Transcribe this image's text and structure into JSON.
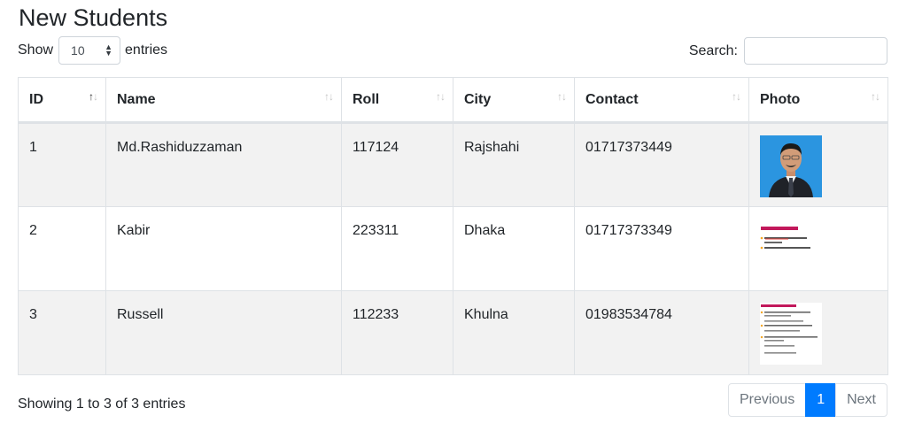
{
  "page": {
    "title": "New Students"
  },
  "length_control": {
    "show_label": "Show",
    "selected": "10",
    "entries_label": "entries"
  },
  "search": {
    "label": "Search:",
    "value": "",
    "placeholder": ""
  },
  "table": {
    "columns": [
      "ID",
      "Name",
      "Roll",
      "City",
      "Contact",
      "Photo"
    ],
    "sorted_column": "ID",
    "sort_direction": "ascending",
    "rows": [
      {
        "id": "1",
        "name": "Md.Rashiduzzaman",
        "roll": "117124",
        "city": "Rajshahi",
        "contact": "01717373449",
        "photo": "portrait-photo"
      },
      {
        "id": "2",
        "name": "Kabir",
        "roll": "223311",
        "city": "Dhaka",
        "contact": "01717373349",
        "photo": "slide-thumbnail-virtual-function"
      },
      {
        "id": "3",
        "name": "Russell",
        "roll": "112233",
        "city": "Khulna",
        "contact": "01983534784",
        "photo": "slide-thumbnail-constructor-destructor"
      }
    ]
  },
  "info": {
    "text": "Showing 1 to 3 of 3 entries"
  },
  "pagination": {
    "previous": "Previous",
    "current": "1",
    "next": "Next"
  },
  "colors": {
    "accent": "#007bff",
    "row_stripe": "#f2f2f2",
    "border": "#dee2e6"
  }
}
